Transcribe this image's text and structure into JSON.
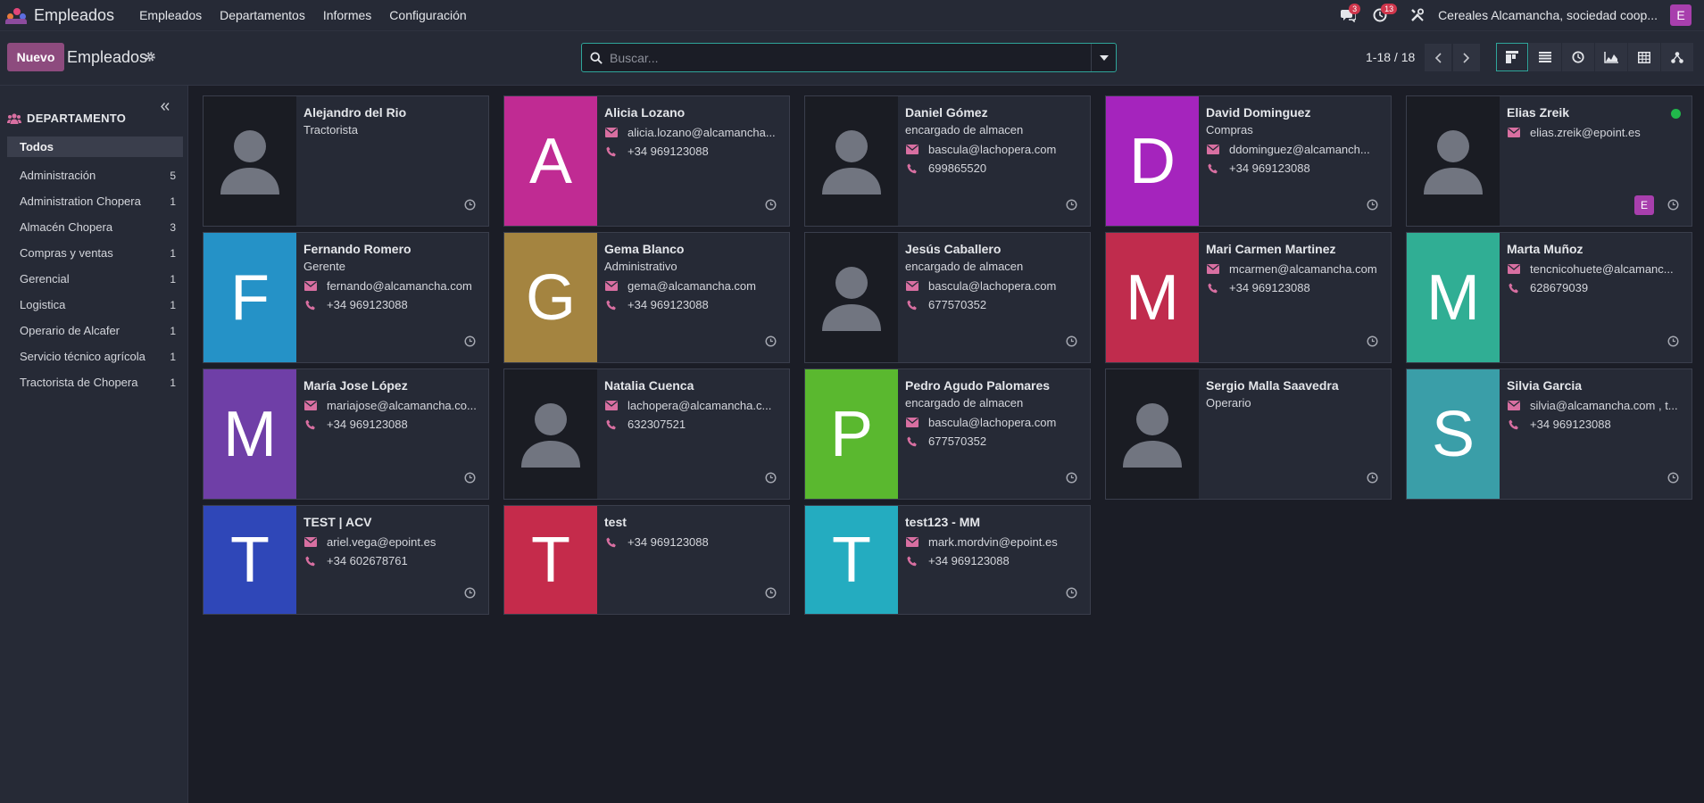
{
  "app": {
    "title": "Empleados",
    "menu": [
      "Empleados",
      "Departamentos",
      "Informes",
      "Configuración"
    ],
    "messages_count": "3",
    "activities_count": "13",
    "company": "Cereales Alcamancha, sociedad coop...",
    "user_initial": "E"
  },
  "control": {
    "new_label": "Nuevo",
    "breadcrumb": "Empleados",
    "search_placeholder": "Buscar...",
    "pager": "1-18 / 18"
  },
  "sidebar": {
    "header": "DEPARTAMENTO",
    "items": [
      {
        "label": "Todos",
        "count": ""
      },
      {
        "label": "Administración",
        "count": "5"
      },
      {
        "label": "Administration Chopera",
        "count": "1"
      },
      {
        "label": "Almacén Chopera",
        "count": "3"
      },
      {
        "label": "Compras y ventas",
        "count": "1"
      },
      {
        "label": "Gerencial",
        "count": "1"
      },
      {
        "label": "Logistica",
        "count": "1"
      },
      {
        "label": "Operario de Alcafer",
        "count": "1"
      },
      {
        "label": "Servicio técnico agrícola",
        "count": "1"
      },
      {
        "label": "Tractorista de Chopera",
        "count": "1"
      }
    ]
  },
  "employees": [
    {
      "name": "Alejandro del Rio",
      "job": "Tractorista",
      "email": "",
      "phone": "",
      "initial": "",
      "color": ""
    },
    {
      "name": "Alicia Lozano",
      "job": "",
      "email": "alicia.lozano@alcamancha...",
      "phone": "+34 969123088",
      "initial": "A",
      "color": "#c02b93"
    },
    {
      "name": "Daniel Gómez",
      "job": "encargado de almacen",
      "email": "bascula@lachopera.com",
      "phone": "699865520",
      "initial": "",
      "color": ""
    },
    {
      "name": "David Dominguez",
      "job": "Compras",
      "email": "ddominguez@alcamanch...",
      "phone": "+34 969123088",
      "initial": "D",
      "color": "#a524bd"
    },
    {
      "name": "Elias Zreik",
      "job": "",
      "email": "elias.zreik@epoint.es",
      "phone": "",
      "initial": "",
      "color": "",
      "online": true,
      "user": "E"
    },
    {
      "name": "Fernando Romero",
      "job": "Gerente",
      "email": "fernando@alcamancha.com",
      "phone": "+34 969123088",
      "initial": "F",
      "color": "#2592c7"
    },
    {
      "name": "Gema Blanco",
      "job": "Administrativo",
      "email": "gema@alcamancha.com",
      "phone": "+34 969123088",
      "initial": "G",
      "color": "#a48440"
    },
    {
      "name": "Jesús Caballero",
      "job": "encargado de almacen",
      "email": "bascula@lachopera.com",
      "phone": "677570352",
      "initial": "",
      "color": ""
    },
    {
      "name": "Mari Carmen Martinez",
      "job": "",
      "email": "mcarmen@alcamancha.com",
      "phone": "+34 969123088",
      "initial": "M",
      "color": "#c02c4d"
    },
    {
      "name": "Marta Muñoz",
      "job": "",
      "email": "tencnicohuete@alcamanc...",
      "phone": "628679039",
      "initial": "M",
      "color": "#30ae94"
    },
    {
      "name": "María Jose López",
      "job": "",
      "email": "mariajose@alcamancha.co...",
      "phone": "+34 969123088",
      "initial": "M",
      "color": "#6f3fa7"
    },
    {
      "name": "Natalia Cuenca",
      "job": "",
      "email": "lachopera@alcamancha.c...",
      "phone": "632307521",
      "initial": "",
      "color": ""
    },
    {
      "name": "Pedro Agudo Palomares",
      "job": "encargado de almacen",
      "email": "bascula@lachopera.com",
      "phone": "677570352",
      "initial": "P",
      "color": "#5ab82f"
    },
    {
      "name": "Sergio Malla Saavedra",
      "job": "Operario",
      "email": "",
      "phone": "",
      "initial": "",
      "color": ""
    },
    {
      "name": "Silvia Garcia",
      "job": "",
      "email": "silvia@alcamancha.com , t...",
      "phone": "+34 969123088",
      "initial": "S",
      "color": "#3a9ea8"
    },
    {
      "name": "TEST | ACV",
      "job": "",
      "email": "ariel.vega@epoint.es",
      "phone": "+34 602678761",
      "initial": "T",
      "color": "#2f47b8"
    },
    {
      "name": "test",
      "job": "",
      "email": "",
      "phone": "+34 969123088",
      "initial": "T",
      "color": "#c52b4b"
    },
    {
      "name": "test123 - MM",
      "job": "",
      "email": "mark.mordvin@epoint.es",
      "phone": "+34 969123088",
      "initial": "T",
      "color": "#24acc0"
    }
  ]
}
